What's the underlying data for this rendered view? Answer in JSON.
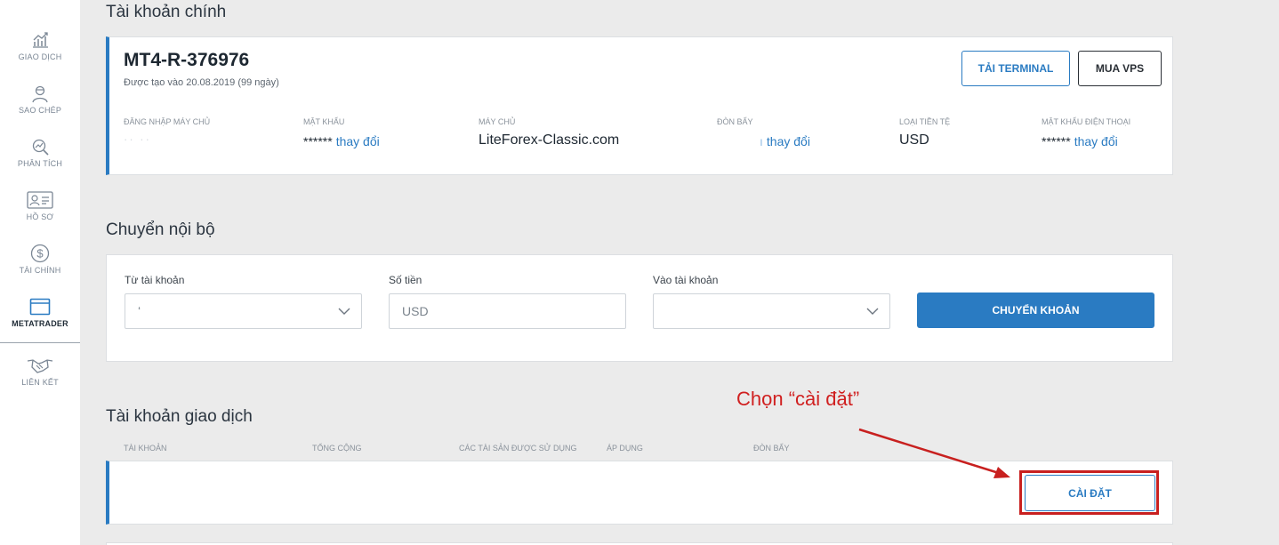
{
  "sidebar": {
    "items": [
      {
        "label": "GIAO DỊCH",
        "icon": "chart-growth-icon"
      },
      {
        "label": "SAO CHÉP",
        "icon": "user-copy-icon"
      },
      {
        "label": "PHÂN TÍCH",
        "icon": "analysis-icon"
      },
      {
        "label": "HỒ SƠ",
        "icon": "profile-card-icon"
      },
      {
        "label": "TÀI CHÍNH",
        "icon": "dollar-icon"
      },
      {
        "label": "METATRADER",
        "icon": "window-icon",
        "active": true
      },
      {
        "label": "LIÊN KẾT",
        "icon": "handshake-icon"
      }
    ]
  },
  "main_account": {
    "section_title": "Tài khoản chính",
    "name": "MT4-R-376976",
    "created": "Được tạo vào 20.08.2019 (99 ngày)",
    "download_terminal_label": "TẢI TERMINAL",
    "buy_vps_label": "MUA VPS",
    "fields": {
      "login_label": "ĐĂNG NHẬP MÁY CHỦ",
      "password_label": "MẬT KHẨU",
      "password_value": "******",
      "password_change": "thay đổi",
      "server_label": "MÁY CHỦ",
      "server_value": "LiteForex-Classic.com",
      "leverage_label": "ĐÒN BẨY",
      "leverage_value": "ı",
      "leverage_change": "thay đổi",
      "currency_label": "LOẠI TIỀN TỆ",
      "currency_value": "USD",
      "phone_password_label": "MẬT KHẨU ĐIỆN THOẠI",
      "phone_password_value": "******",
      "phone_password_change": "thay đổi"
    }
  },
  "transfer": {
    "section_title": "Chuyển nội bộ",
    "from_label": "Từ tài khoản",
    "from_value": "ʻ",
    "amount_label": "Số tiền",
    "amount_placeholder": "USD",
    "to_label": "Vào tài khoản",
    "to_value": "",
    "submit_label": "CHUYỂN KHOẢN"
  },
  "trading_accounts": {
    "section_title": "Tài khoản giao dịch",
    "columns": [
      "TÀI KHOẢN",
      "TỔNG CỘNG",
      "CÁC TÀI SẢN ĐƯỢC SỬ DỤNG",
      "ÁP DỤNG",
      "ĐÒN BẨY"
    ],
    "settings_label": "CÀI ĐẶT"
  },
  "annotation": {
    "text": "Chọn “cài đặt”",
    "color": "#d02020"
  },
  "colors": {
    "accent": "#2a7bc2",
    "background": "#ebebeb"
  }
}
